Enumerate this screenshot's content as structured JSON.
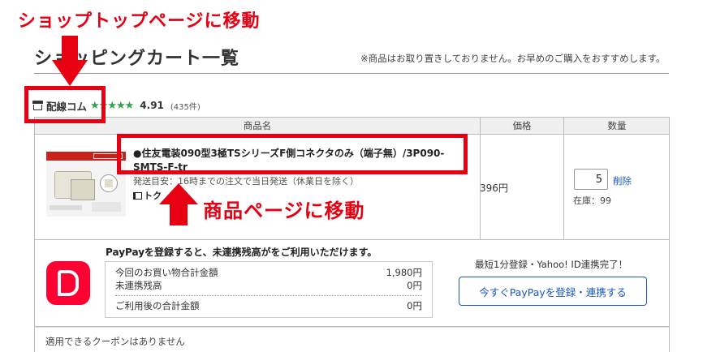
{
  "page": {
    "title": "ショッピングカート一覧",
    "note": "※商品はお取り置きしておりません。お早めのご購入をおすすめします。"
  },
  "store": {
    "icon": "shop-icon",
    "name": "配線コム",
    "stars": "★★★★★",
    "rating": "4.91",
    "review_count": "(435件)",
    "star_color": "#2ea44f"
  },
  "table": {
    "headers": {
      "product": "商品名",
      "price": "価格",
      "quantity": "数量"
    }
  },
  "item": {
    "name": "●住友電装090型3極TSシリーズF側コネクタのみ（端子無）/3P090-SMTS-F-tr",
    "shipping_note": "発送目安：16時までの注文で当日発送（休業日を除く）",
    "coupon_tag": "トク",
    "price": "396円",
    "quantity": "5",
    "delete_label": "削除",
    "stock": "在庫：99"
  },
  "paypay": {
    "headline_left": "PayPayを登録すると、未連携残高が",
    "headline_right": "をご利用いただけます。",
    "rows": [
      {
        "label": "今回のお買い物合計金額",
        "value": "1,980円"
      },
      {
        "label": "未連携残高",
        "value": "0円"
      }
    ],
    "total_label": "ご利用後の合計金額",
    "total_value": "0円",
    "register_note": "最短1分登録・Yahoo! ID連携完了！",
    "register_button": "今すぐPayPayを登録・連携する",
    "brand_color": "#ff0033"
  },
  "coupon": {
    "text": "適用できるクーポンはありません"
  },
  "annotations": {
    "top_label": "ショップトップページに移動",
    "mid_label": "商品ページに移動",
    "color": "#e60012"
  }
}
